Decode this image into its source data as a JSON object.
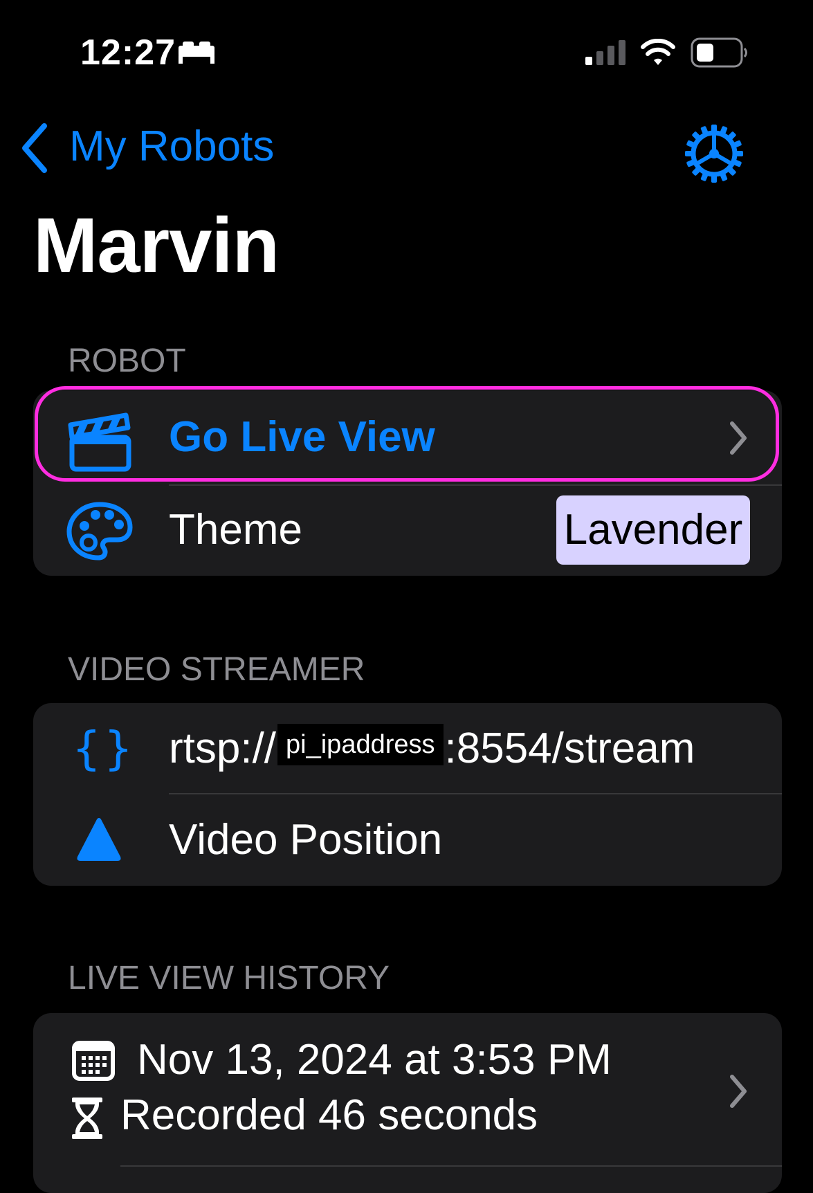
{
  "status_bar": {
    "time": "12:27",
    "focus_icon": "bed-icon",
    "signal_icon": "cellular-signal-icon",
    "wifi_icon": "wifi-icon",
    "battery_icon": "battery-icon"
  },
  "nav": {
    "back_label": "My Robots",
    "settings_icon": "gear-icon",
    "title": "Marvin"
  },
  "sections": {
    "robot": {
      "header": "ROBOT",
      "go_live_label": "Go Live View",
      "theme_label": "Theme",
      "theme_value": "Lavender"
    },
    "video_streamer": {
      "header": "VIDEO STREAMER",
      "url_prefix": "rtsp://",
      "url_redacted": "pi_ipaddress",
      "url_suffix": ":8554/stream",
      "position_label": "Video Position"
    },
    "history": {
      "header": "LIVE VIEW HISTORY",
      "date": "Nov 13, 2024 at 3:53 PM",
      "duration": "Recorded 46 seconds"
    }
  },
  "colors": {
    "accent": "#0a84ff",
    "highlight": "#ff2de1",
    "theme_badge": "#d8d2ff",
    "row_background": "#1c1c1e"
  }
}
